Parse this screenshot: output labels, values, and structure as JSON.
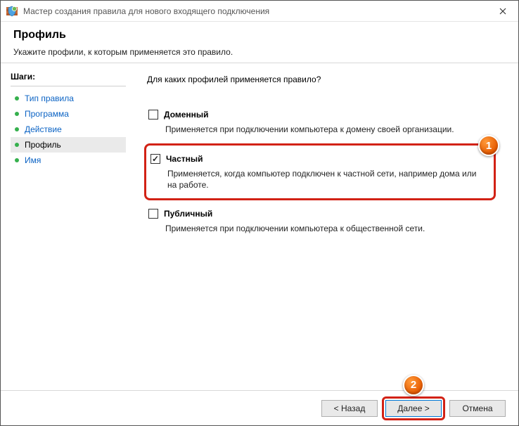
{
  "window": {
    "title": "Мастер создания правила для нового входящего подключения"
  },
  "header": {
    "title": "Профиль",
    "subtitle": "Укажите профили, к которым применяется это правило."
  },
  "sidebar": {
    "steps_title": "Шаги:",
    "items": [
      {
        "label": "Тип правила"
      },
      {
        "label": "Программа"
      },
      {
        "label": "Действие"
      },
      {
        "label": "Профиль"
      },
      {
        "label": "Имя"
      }
    ]
  },
  "main": {
    "question": "Для каких профилей применяется правило?",
    "options": {
      "domain": {
        "label": "Доменный",
        "desc": "Применяется при подключении компьютера к домену своей организации.",
        "checked": ""
      },
      "private": {
        "label": "Частный",
        "desc": "Применяется, когда компьютер подключен к частной сети, например дома или на работе.",
        "checked": "✓"
      },
      "public": {
        "label": "Публичный",
        "desc": "Применяется при подключении компьютера к общественной сети.",
        "checked": ""
      }
    }
  },
  "footer": {
    "back": "< Назад",
    "next": "Далее >",
    "cancel": "Отмена"
  },
  "callouts": {
    "one": "1",
    "two": "2"
  }
}
